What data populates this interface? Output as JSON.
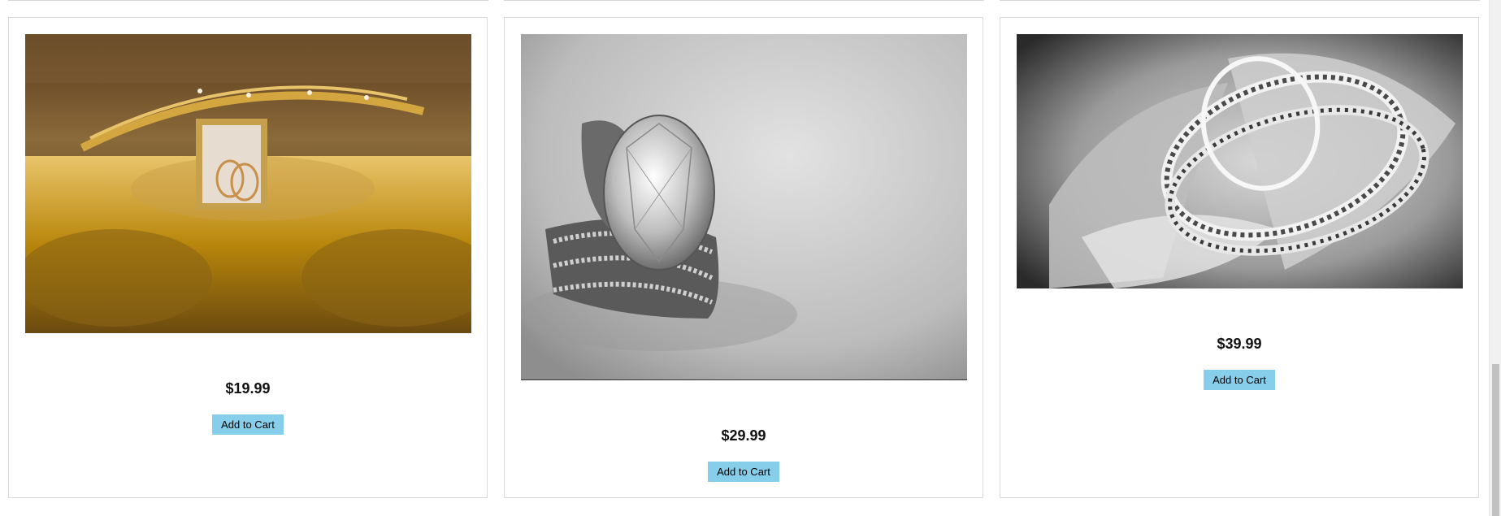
{
  "products": [
    {
      "price": "$19.99",
      "button_label": "Add to Cart",
      "image_icon": "gold-jewelry-box-photo"
    },
    {
      "price": "$29.99",
      "button_label": "Add to Cart",
      "image_icon": "diamond-ring-photo"
    },
    {
      "price": "$39.99",
      "button_label": "Add to Cart",
      "image_icon": "silver-rings-on-rose-photo"
    }
  ],
  "colors": {
    "button_bg": "#87ceeb",
    "card_border": "#d9d9d9",
    "price_text": "#111111"
  }
}
